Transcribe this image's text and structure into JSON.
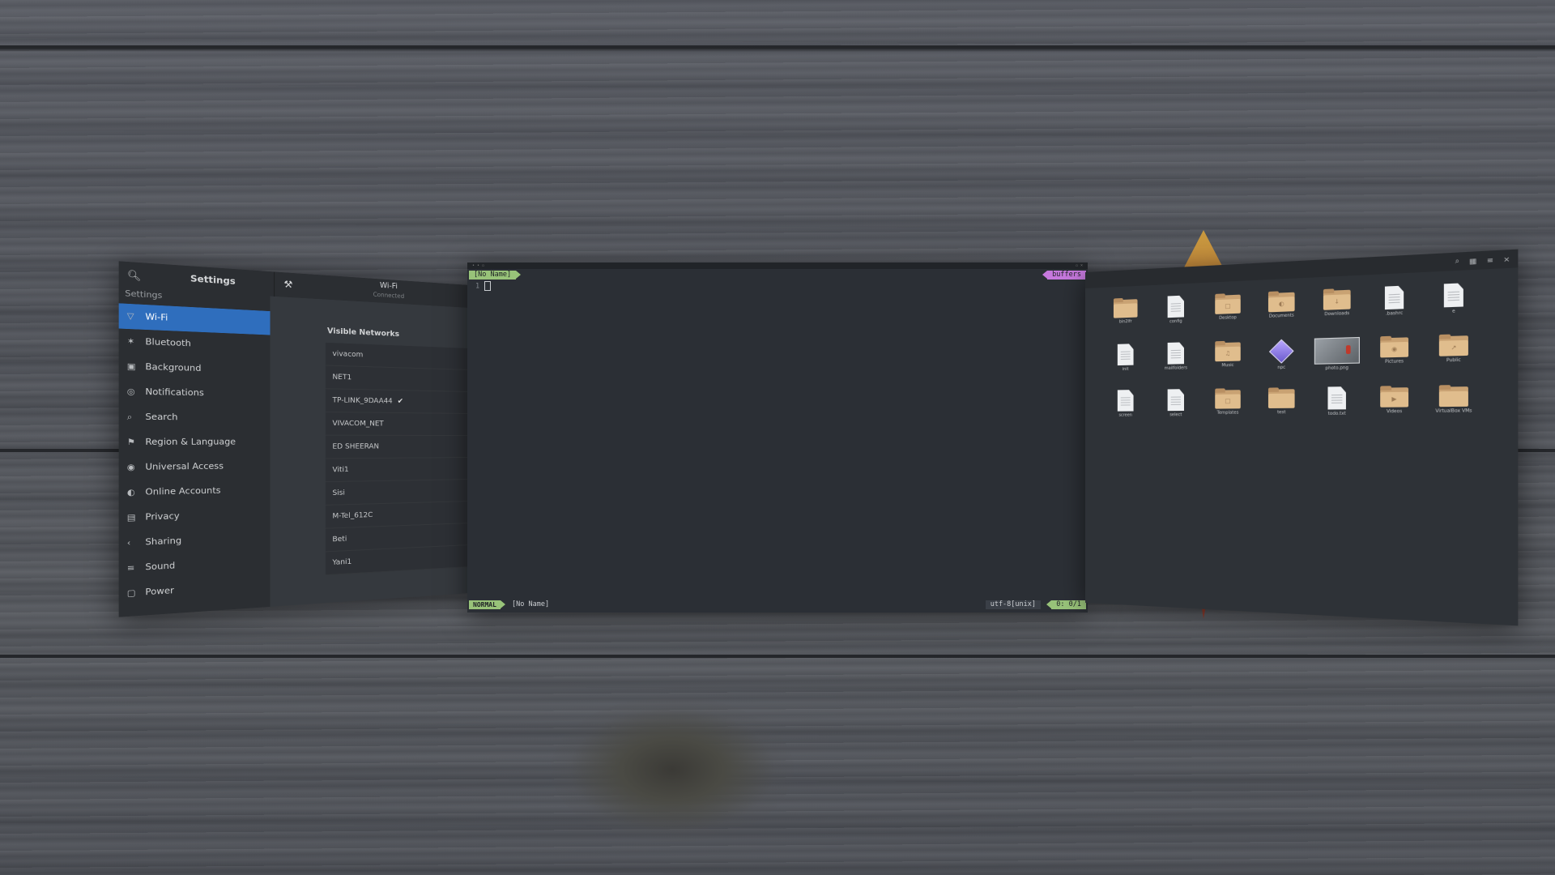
{
  "settings": {
    "title": "Settings",
    "crumb": "Settings",
    "panel_title": "Wi-Fi",
    "panel_subtitle": "Connected",
    "sidebar": [
      {
        "label": "Wi-Fi",
        "icon": "wifi-icon",
        "active": true
      },
      {
        "label": "Bluetooth",
        "icon": "bluetooth-icon"
      },
      {
        "label": "Background",
        "icon": "background-icon"
      },
      {
        "label": "Notifications",
        "icon": "notifications-icon"
      },
      {
        "label": "Search",
        "icon": "search-icon"
      },
      {
        "label": "Region & Language",
        "icon": "region-icon"
      },
      {
        "label": "Universal Access",
        "icon": "accessibility-icon"
      },
      {
        "label": "Online Accounts",
        "icon": "accounts-icon"
      },
      {
        "label": "Privacy",
        "icon": "privacy-icon"
      },
      {
        "label": "Sharing",
        "icon": "sharing-icon"
      },
      {
        "label": "Sound",
        "icon": "sound-icon"
      },
      {
        "label": "Power",
        "icon": "power-icon"
      }
    ],
    "visible_networks_label": "Visible Networks",
    "networks": [
      {
        "name": "vivacom"
      },
      {
        "name": "NET1"
      },
      {
        "name": "TP-LINK_9DAA44",
        "connected": true
      },
      {
        "name": "VIVACOM_NET"
      },
      {
        "name": "ED SHEERAN"
      },
      {
        "name": "Viti1"
      },
      {
        "name": "Sisi"
      },
      {
        "name": "M-Tel_612C"
      },
      {
        "name": "Beti"
      },
      {
        "name": "Yani1"
      }
    ]
  },
  "terminal": {
    "tab_left": "[No Name]",
    "tab_right": "buffers",
    "line_number": "1",
    "mode": "NORMAL",
    "filename": "[No Name]",
    "encoding": "utf-8[unix]",
    "position": "0: 0/1",
    "colors": {
      "green": "#98c379",
      "purple": "#c678dd"
    }
  },
  "files": {
    "items": [
      {
        "label": "bin2lfr",
        "type": "folder"
      },
      {
        "label": "config",
        "type": "doc"
      },
      {
        "label": "Desktop",
        "type": "folder"
      },
      {
        "label": "Documents",
        "type": "folder"
      },
      {
        "label": "Downloads",
        "type": "folder"
      },
      {
        "label": ".bashrc",
        "type": "doc"
      },
      {
        "label": "e",
        "type": "doc"
      },
      {
        "label": "init",
        "type": "doc"
      },
      {
        "label": "mailfolders",
        "type": "doc"
      },
      {
        "label": "Music",
        "type": "folder"
      },
      {
        "label": "npc",
        "type": "gem"
      },
      {
        "label": "photo.png",
        "type": "image"
      },
      {
        "label": "Pictures",
        "type": "folder"
      },
      {
        "label": "Public",
        "type": "folder"
      },
      {
        "label": "screen",
        "type": "doc"
      },
      {
        "label": "select",
        "type": "doc"
      },
      {
        "label": "Templates",
        "type": "folder"
      },
      {
        "label": "test",
        "type": "folder"
      },
      {
        "label": "todo.txt",
        "type": "doc"
      },
      {
        "label": "Videos",
        "type": "folder"
      },
      {
        "label": "VirtualBox VMs",
        "type": "folder"
      }
    ]
  }
}
